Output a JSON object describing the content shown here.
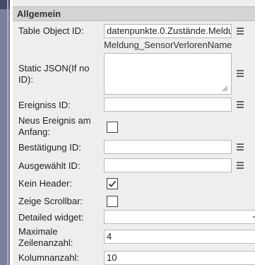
{
  "section": {
    "title": "Allgemein"
  },
  "fields": {
    "table_object_id": {
      "label": "Table Object ID:",
      "value": "datenpunkte.0.Zustände.Meldung_SensorVerlorenName",
      "hint": "Meldung_SensorVerlorenName"
    },
    "static_json": {
      "label": "Static JSON(If no ID):",
      "value": ""
    },
    "ereigniss_id": {
      "label": "Ereigniss ID:",
      "value": ""
    },
    "neus_ereignis": {
      "label": "Neus Ereignis am Anfang:",
      "checked": false
    },
    "bestaetigung_id": {
      "label": "Bestätigung ID:",
      "value": ""
    },
    "ausgewaehlt_id": {
      "label": "Ausgewählt ID:",
      "value": ""
    },
    "kein_header": {
      "label": "Kein Header:",
      "checked": true
    },
    "zeige_scrollbar": {
      "label": "Zeige Scrollbar:",
      "checked": false
    },
    "detailed_widget": {
      "label": "Detailed widget:",
      "value": ""
    },
    "maximale_zeilen": {
      "label": "Maximale Zeilenanzahl:",
      "value": "4"
    },
    "kolumnanzahl": {
      "label": "Kolumnanzahl:",
      "value": "10"
    }
  },
  "icons": {
    "select_button": "list-icon",
    "checkmark": "check-icon",
    "resize": "resize-grip-icon",
    "dropdown": "chevron-down-icon"
  }
}
